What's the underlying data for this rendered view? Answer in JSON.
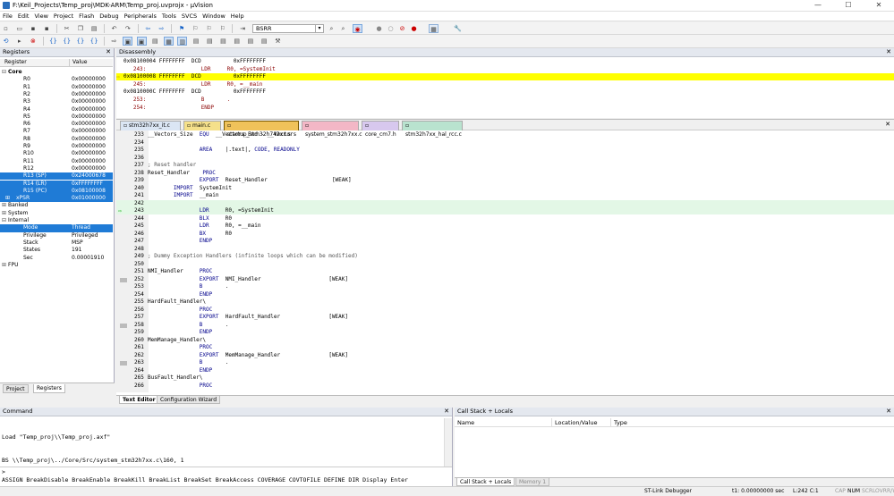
{
  "titlebar": {
    "title": "F:\\Keil_Projects\\Temp_proj\\MDK-ARM\\Temp_proj.uvprojx - µVision",
    "minimize": "—",
    "maximize": "☐",
    "close": "✕"
  },
  "menu": [
    "File",
    "Edit",
    "View",
    "Project",
    "Flash",
    "Debug",
    "Peripherals",
    "Tools",
    "SVCS",
    "Window",
    "Help"
  ],
  "toolbar": {
    "find_value": "BSRR"
  },
  "registers": {
    "title": "Registers",
    "col_register": "Register",
    "col_value": "Value",
    "rows": [
      {
        "name": "Core",
        "value": "",
        "indent": 0,
        "prefix": "⊟",
        "bold": true,
        "selected": false
      },
      {
        "name": "R0",
        "value": "0x00000000",
        "indent": 2,
        "prefix": "",
        "selected": false
      },
      {
        "name": "R1",
        "value": "0x00000000",
        "indent": 2,
        "prefix": "",
        "selected": false
      },
      {
        "name": "R2",
        "value": "0x00000000",
        "indent": 2,
        "prefix": "",
        "selected": false
      },
      {
        "name": "R3",
        "value": "0x00000000",
        "indent": 2,
        "prefix": "",
        "selected": false
      },
      {
        "name": "R4",
        "value": "0x00000000",
        "indent": 2,
        "prefix": "",
        "selected": false
      },
      {
        "name": "R5",
        "value": "0x00000000",
        "indent": 2,
        "prefix": "",
        "selected": false
      },
      {
        "name": "R6",
        "value": "0x00000000",
        "indent": 2,
        "prefix": "",
        "selected": false
      },
      {
        "name": "R7",
        "value": "0x00000000",
        "indent": 2,
        "prefix": "",
        "selected": false
      },
      {
        "name": "R8",
        "value": "0x00000000",
        "indent": 2,
        "prefix": "",
        "selected": false
      },
      {
        "name": "R9",
        "value": "0x00000000",
        "indent": 2,
        "prefix": "",
        "selected": false
      },
      {
        "name": "R10",
        "value": "0x00000000",
        "indent": 2,
        "prefix": "",
        "selected": false
      },
      {
        "name": "R11",
        "value": "0x00000000",
        "indent": 2,
        "prefix": "",
        "selected": false
      },
      {
        "name": "R12",
        "value": "0x00000000",
        "indent": 2,
        "prefix": "",
        "selected": false
      },
      {
        "name": "R13 (SP)",
        "value": "0x24000678",
        "indent": 2,
        "prefix": "",
        "selected": true
      },
      {
        "name": "R14 (LR)",
        "value": "0xFFFFFFFF",
        "indent": 2,
        "prefix": "",
        "selected": true
      },
      {
        "name": "R15 (PC)",
        "value": "0x08100008",
        "indent": 2,
        "prefix": "",
        "selected": true
      },
      {
        "name": "xPSR",
        "value": "0x01000000",
        "indent": 1,
        "prefix": "⊞",
        "selected": true
      },
      {
        "name": "Banked",
        "value": "",
        "indent": 0,
        "prefix": "⊞",
        "selected": false
      },
      {
        "name": "System",
        "value": "",
        "indent": 0,
        "prefix": "⊞",
        "selected": false
      },
      {
        "name": "Internal",
        "value": "",
        "indent": 0,
        "prefix": "⊟",
        "selected": false
      },
      {
        "name": "Mode",
        "value": "Thread",
        "indent": 2,
        "prefix": "",
        "selected": true
      },
      {
        "name": "Privilege",
        "value": "Privileged",
        "indent": 2,
        "prefix": "",
        "selected": false
      },
      {
        "name": "Stack",
        "value": "MSP",
        "indent": 2,
        "prefix": "",
        "selected": false
      },
      {
        "name": "States",
        "value": "191",
        "indent": 2,
        "prefix": "",
        "selected": false
      },
      {
        "name": "Sec",
        "value": "0.00001910",
        "indent": 2,
        "prefix": "",
        "selected": false
      },
      {
        "name": "FPU",
        "value": "",
        "indent": 0,
        "prefix": "⊞",
        "selected": false
      }
    ],
    "tab_project": "Project",
    "tab_registers": "Registers"
  },
  "disassembly": {
    "title": "Disassembly",
    "lines": [
      {
        "text": "0x08100004 FFFFFFFF  DCD          0xFFFFFFFF",
        "hl": false,
        "src": false
      },
      {
        "text": "   243:                 LDR     R0, =SystemInit",
        "hl": false,
        "src": true
      },
      {
        "text": "0x08100008 FFFFFFFF  DCD          0xFFFFFFFF",
        "hl": true,
        "src": false
      },
      {
        "text": "   245:                 LDR     R0, =__main",
        "hl": false,
        "src": true
      },
      {
        "text": "0x0810000C FFFFFFFF  DCD          0xFFFFFFFF",
        "hl": false,
        "src": false
      },
      {
        "text": "   253:                 B       .",
        "hl": false,
        "src": true
      },
      {
        "text": "   254:                 ENDP",
        "hl": false,
        "src": true
      }
    ]
  },
  "editor": {
    "file_tabs": [
      {
        "label": "stm32h7xx_it.c",
        "color": "#dbe6f4",
        "active": false
      },
      {
        "label": "main.c",
        "color": "#f5e08a",
        "active": false
      },
      {
        "label": "startup_stm32h742xx.s",
        "color": "#f0c25a",
        "active": true
      },
      {
        "label": "system_stm32h7xx.c",
        "color": "#f3b7c6",
        "active": false
      },
      {
        "label": "core_cm7.h",
        "color": "#d7c8ee",
        "active": false
      },
      {
        "label": "stm32h7xx_hal_rcc.c",
        "color": "#b9e3cf",
        "active": false
      }
    ],
    "lines": [
      {
        "n": "233",
        "t": "__Vectors_Size  EQU  __Vectors_End - __Vectors",
        "c": "",
        "m": false
      },
      {
        "n": "234",
        "t": "",
        "c": "",
        "m": false
      },
      {
        "n": "235",
        "t": "                AREA    |.text|, CODE, READONLY",
        "c": "",
        "m": false
      },
      {
        "n": "236",
        "t": "",
        "c": "",
        "m": false
      },
      {
        "n": "237",
        "t": "; Reset handler",
        "c": "cm",
        "m": false
      },
      {
        "n": "238",
        "t": "Reset_Handler    PROC",
        "c": "",
        "m": false
      },
      {
        "n": "239",
        "t": "                EXPORT  Reset_Handler                    [WEAK]",
        "c": "",
        "m": false
      },
      {
        "n": "240",
        "t": "        IMPORT  SystemInit",
        "c": "",
        "m": false
      },
      {
        "n": "241",
        "t": "        IMPORT  __main",
        "c": "",
        "m": false
      },
      {
        "n": "242",
        "t": "",
        "c": "",
        "m": false
      },
      {
        "n": "243",
        "t": "                LDR     R0, =SystemInit",
        "c": "",
        "m": true
      },
      {
        "n": "244",
        "t": "                BLX     R0",
        "c": "",
        "m": false
      },
      {
        "n": "245",
        "t": "                LDR     R0, =__main",
        "c": "",
        "m": false
      },
      {
        "n": "246",
        "t": "                BX      R0",
        "c": "",
        "m": false
      },
      {
        "n": "247",
        "t": "                ENDP",
        "c": "",
        "m": false
      },
      {
        "n": "248",
        "t": "",
        "c": "",
        "m": false
      },
      {
        "n": "249",
        "t": "; Dummy Exception Handlers (infinite loops which can be modified)",
        "c": "cm",
        "m": false
      },
      {
        "n": "250",
        "t": "",
        "c": "",
        "m": false
      },
      {
        "n": "251",
        "t": "NMI_Handler     PROC",
        "c": "",
        "m": false
      },
      {
        "n": "252",
        "t": "                EXPORT  NMI_Handler                     [WEAK]",
        "c": "",
        "m": false
      },
      {
        "n": "253",
        "t": "                B       .",
        "c": "",
        "m": false
      },
      {
        "n": "254",
        "t": "                ENDP",
        "c": "",
        "m": false
      },
      {
        "n": "255",
        "t": "HardFault_Handler\\",
        "c": "",
        "m": false
      },
      {
        "n": "256",
        "t": "                PROC",
        "c": "",
        "m": false
      },
      {
        "n": "257",
        "t": "                EXPORT  HardFault_Handler               [WEAK]",
        "c": "",
        "m": false
      },
      {
        "n": "258",
        "t": "                B       .",
        "c": "",
        "m": false
      },
      {
        "n": "259",
        "t": "                ENDP",
        "c": "",
        "m": false
      },
      {
        "n": "260",
        "t": "MemManage_Handler\\",
        "c": "",
        "m": false
      },
      {
        "n": "261",
        "t": "                PROC",
        "c": "",
        "m": false
      },
      {
        "n": "262",
        "t": "                EXPORT  MemManage_Handler               [WEAK]",
        "c": "",
        "m": false
      },
      {
        "n": "263",
        "t": "                B       .",
        "c": "",
        "m": false
      },
      {
        "n": "264",
        "t": "                ENDP",
        "c": "",
        "m": false
      },
      {
        "n": "265",
        "t": "BusFault_Handler\\",
        "c": "",
        "m": false
      },
      {
        "n": "266",
        "t": "                PROC",
        "c": "",
        "m": false
      }
    ],
    "tab_text_editor": "Text Editor",
    "tab_config_wizard": "Configuration Wizard"
  },
  "command": {
    "title": "Command",
    "output": [
      "Load \"Temp_proj\\\\Temp_proj.axf\"",
      "BS \\\\Temp_proj\\../Core/Src/system_stm32h7xx.c\\160, 1"
    ],
    "prompt": ">",
    "hint": "ASSIGN BreakDisable BreakEnable BreakKill BreakList BreakSet BreakAccess COVERAGE COVTOFILE DEFINE DIR Display Enter"
  },
  "callstack": {
    "title": "Call Stack + Locals",
    "col_name": "Name",
    "col_location": "Location/Value",
    "col_type": "Type",
    "tab_callstack": "Call Stack + Locals",
    "tab_memory": "Memory 1"
  },
  "status": {
    "debugger": "ST-Link Debugger",
    "time": "t1: 0.00000000 sec",
    "position": "L:242 C:1",
    "caps": "CAP",
    "num": "NUM",
    "scrl": "SCRL",
    "ovr": "OVR",
    "rw": "R/W"
  }
}
